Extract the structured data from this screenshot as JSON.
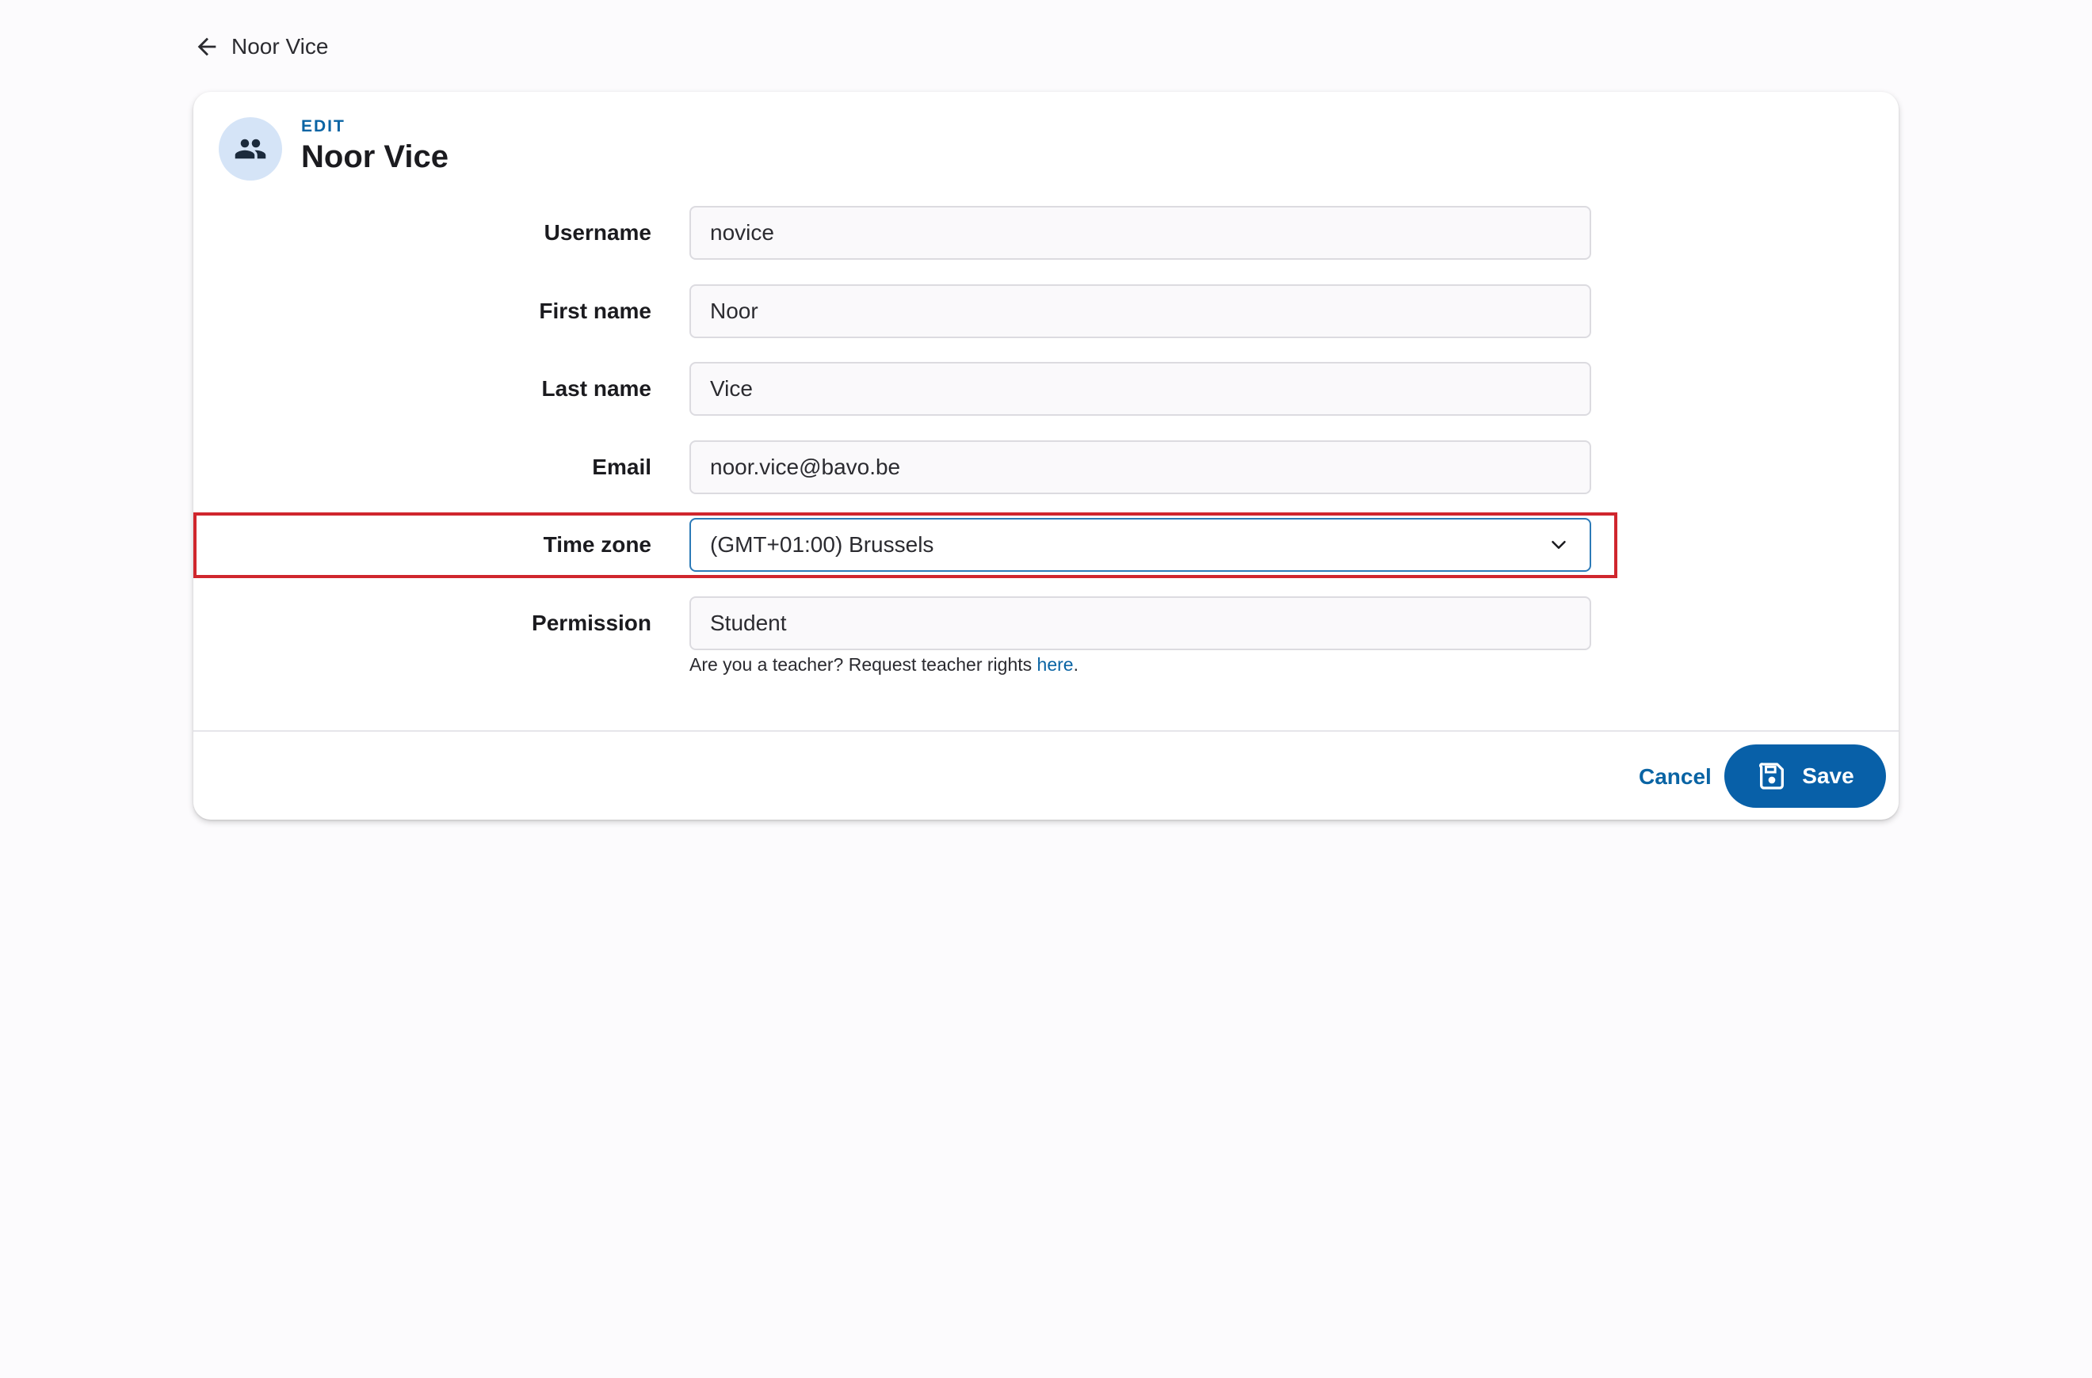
{
  "header": {
    "back_label": "Noor Vice"
  },
  "card": {
    "eyebrow": "EDIT",
    "title": "Noor Vice"
  },
  "form": {
    "username": {
      "label": "Username",
      "value": "novice"
    },
    "first_name": {
      "label": "First name",
      "value": "Noor"
    },
    "last_name": {
      "label": "Last name",
      "value": "Vice"
    },
    "email": {
      "label": "Email",
      "value": "noor.vice@bavo.be"
    },
    "time_zone": {
      "label": "Time zone",
      "value": "(GMT+01:00) Brussels"
    },
    "permission": {
      "label": "Permission",
      "value": "Student"
    },
    "hint_text": "Are you a teacher? Request teacher rights ",
    "hint_link": "here",
    "hint_end": "."
  },
  "actions": {
    "cancel_label": "Cancel",
    "save_label": "Save"
  },
  "icons": {
    "back": "arrow-left-icon",
    "avatar": "people-icon",
    "dropdown": "chevron-down-icon",
    "save": "floppy-disk-icon"
  },
  "colors": {
    "accent": "#0a64a4",
    "save_button": "#0860a8",
    "highlight": "#d0262d",
    "avatar_bg": "#d5e4f7"
  }
}
